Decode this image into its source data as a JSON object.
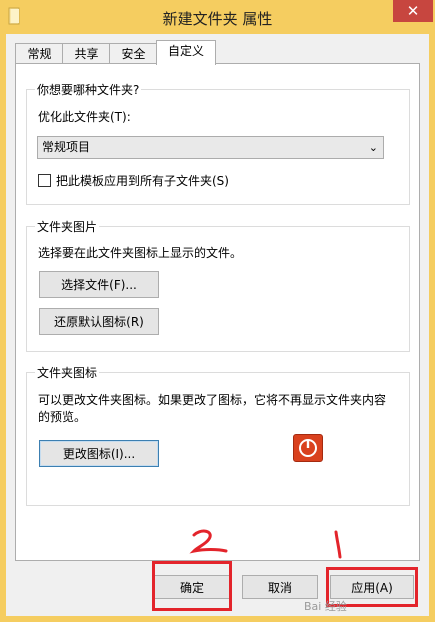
{
  "window": {
    "title": "新建文件夹 属性",
    "close_glyph": "✕"
  },
  "tabs": [
    {
      "label": "常规"
    },
    {
      "label": "共享"
    },
    {
      "label": "安全"
    },
    {
      "label": "自定义",
      "active": true
    }
  ],
  "type_group": {
    "title": "你想要哪种文件夹?",
    "optimize_label": "优化此文件夹(T):",
    "select_value": "常规项目",
    "checkbox_label": "把此模板应用到所有子文件夹(S)",
    "checkbox_checked": false
  },
  "pictures_group": {
    "title": "文件夹图片",
    "description": "选择要在此文件夹图标上显示的文件。",
    "choose_file_button": "选择文件(F)...",
    "restore_default_button": "还原默认图标(R)"
  },
  "icons_group": {
    "title": "文件夹图标",
    "description_line1": "可以更改文件夹图标。如果更改了图标，它将不再显示文件夹内容",
    "description_line2": "的预览。",
    "change_icon_button": "更改图标(I)...",
    "preview_icon": "power-icon"
  },
  "footer": {
    "ok_button": "确定",
    "cancel_button": "取消",
    "apply_button": "应用(A)"
  },
  "annotations": {
    "mark_1": "1",
    "mark_2": "2",
    "box_color": "#e3242b"
  }
}
